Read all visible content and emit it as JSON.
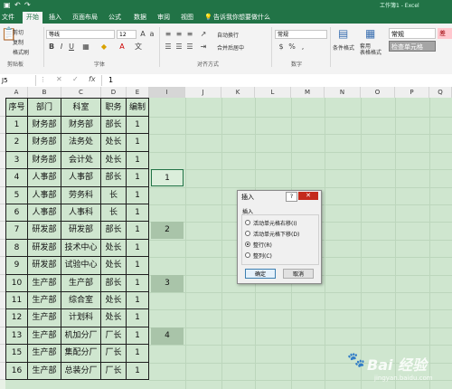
{
  "titlebar": {
    "title": "工作簿1 - Excel"
  },
  "tabs": [
    {
      "label": "文件"
    },
    {
      "label": "开始"
    },
    {
      "label": "插入"
    },
    {
      "label": "页面布局"
    },
    {
      "label": "公式"
    },
    {
      "label": "数据"
    },
    {
      "label": "审阅"
    },
    {
      "label": "视图"
    },
    {
      "label": "告诉我你想要做什么"
    }
  ],
  "ribbon": {
    "clipboard": {
      "cut": "剪切",
      "copy": "复制",
      "format_painter": "格式刷",
      "group": "剪贴板"
    },
    "font": {
      "name": "等线",
      "size": "12",
      "group": "字体"
    },
    "alignment": {
      "wrap": "自动换行",
      "merge": "合并后居中",
      "group": "对齐方式"
    },
    "number": {
      "format": "常规",
      "group": "数字"
    },
    "styles": {
      "conditional": "条件格式",
      "table": "套用\n表格格式",
      "normal": "常规",
      "check_cell": "检查单元格",
      "bad": "差"
    }
  },
  "formula_bar": {
    "name_box": "J5",
    "value": "1"
  },
  "columns": [
    "A",
    "B",
    "C",
    "D",
    "E",
    "I",
    "J",
    "K",
    "L",
    "M",
    "N",
    "O",
    "P",
    "Q"
  ],
  "headers": [
    "序号",
    "部门",
    "科室",
    "职务",
    "编制"
  ],
  "rows": [
    [
      "1",
      "财务部",
      "财务部",
      "部长",
      "1"
    ],
    [
      "2",
      "财务部",
      "法务处",
      "处长",
      "1"
    ],
    [
      "3",
      "财务部",
      "会计处",
      "处长",
      "1"
    ],
    [
      "4",
      "人事部",
      "人事部",
      "部长",
      "1"
    ],
    [
      "5",
      "人事部",
      "劳务科",
      "长",
      "1"
    ],
    [
      "6",
      "人事部",
      "人事科",
      "长",
      "1"
    ],
    [
      "7",
      "研发部",
      "研发部",
      "部长",
      "1"
    ],
    [
      "8",
      "研发部",
      "技术中心",
      "处长",
      "1"
    ],
    [
      "9",
      "研发部",
      "试验中心",
      "处长",
      "1"
    ],
    [
      "10",
      "生产部",
      "生产部",
      "部长",
      "1"
    ],
    [
      "11",
      "生产部",
      "综合室",
      "处长",
      "1"
    ],
    [
      "12",
      "生产部",
      "计划科",
      "处长",
      "1"
    ],
    [
      "13",
      "生产部",
      "机加分厂",
      "厂长",
      "1"
    ],
    [
      "15",
      "生产部",
      "集配分厂",
      "厂长",
      "1"
    ],
    [
      "16",
      "生产部",
      "总装分厂",
      "厂长",
      "1"
    ]
  ],
  "helper_column": [
    {
      "row": 4,
      "value": "1"
    },
    {
      "row": 7,
      "value": "2"
    },
    {
      "row": 10,
      "value": "3"
    },
    {
      "row": 13,
      "value": "4"
    }
  ],
  "dialog": {
    "title": "插入",
    "help": "?",
    "group_label": "插入",
    "options": [
      {
        "label": "活动单元格右移(I)",
        "selected": false
      },
      {
        "label": "活动单元格下移(D)",
        "selected": false
      },
      {
        "label": "整行(R)",
        "selected": true
      },
      {
        "label": "整列(C)",
        "selected": false
      }
    ],
    "ok": "确定",
    "cancel": "取消"
  },
  "watermark": {
    "brand": "Bai 经验",
    "url": "jingyan.baidu.com"
  }
}
